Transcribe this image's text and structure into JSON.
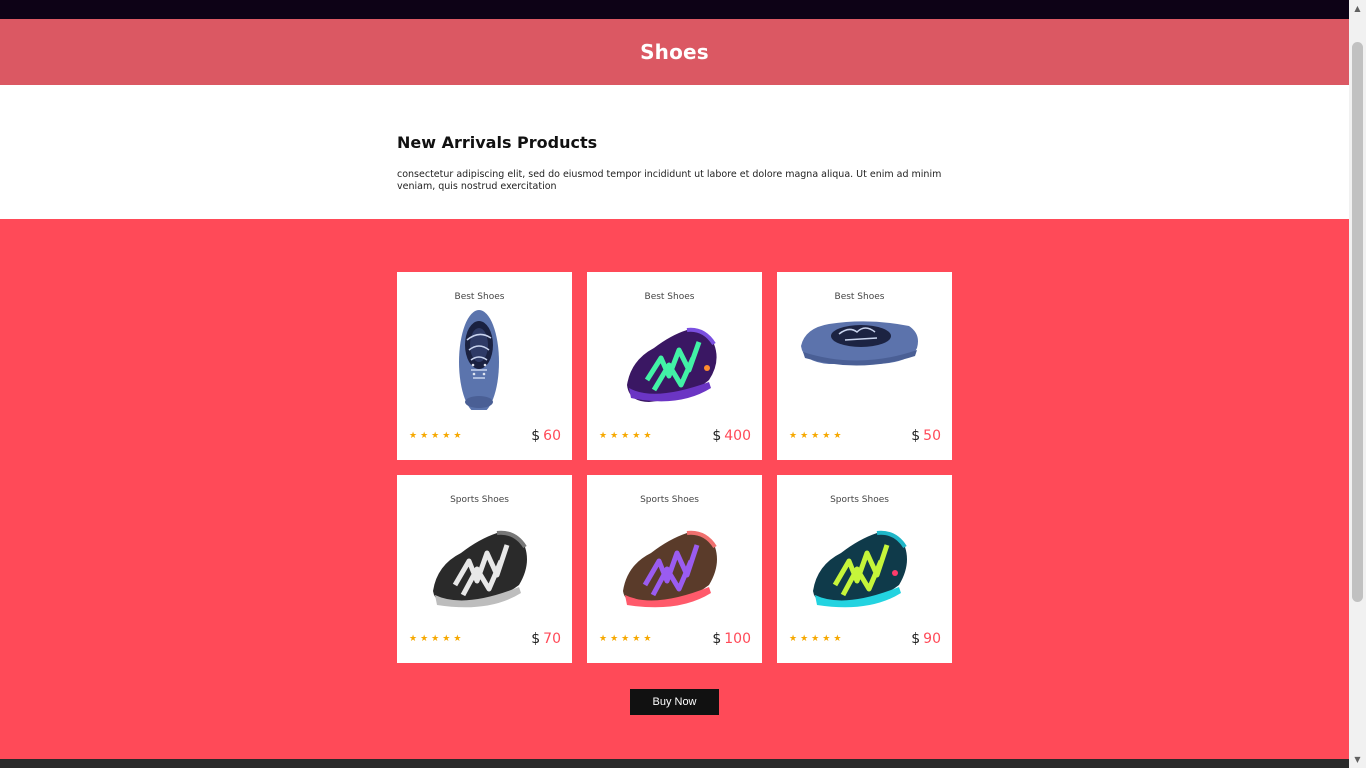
{
  "header": {
    "title": "Shoes"
  },
  "intro": {
    "heading": "New Arrivals Products",
    "text": "consectetur adipiscing elit, sed do eiusmod tempor incididunt ut labore et dolore magna aliqua. Ut enim ad minim veniam, quis nostrud exercitation"
  },
  "products": [
    {
      "category": "Best Shoes",
      "currency": "$",
      "price": "60",
      "rating": 5,
      "image": "blue-canvas-shoe-top-view"
    },
    {
      "category": "Best Shoes",
      "currency": "$",
      "price": "400",
      "rating": 5,
      "image": "purple-green-trail-runner"
    },
    {
      "category": "Best Shoes",
      "currency": "$",
      "price": "50",
      "rating": 5,
      "image": "blue-canvas-shoe-side-view"
    },
    {
      "category": "Sports Shoes",
      "currency": "$",
      "price": "70",
      "rating": 5,
      "image": "black-white-trail-runner"
    },
    {
      "category": "Sports Shoes",
      "currency": "$",
      "price": "100",
      "rating": 5,
      "image": "brown-purple-trail-runner"
    },
    {
      "category": "Sports Shoes",
      "currency": "$",
      "price": "90",
      "rating": 5,
      "image": "teal-lime-trail-runner"
    }
  ],
  "cta": {
    "label": "Buy Now"
  },
  "colors": {
    "topbar": "#0d0216",
    "banner": "#db5863",
    "products_bg": "#ff4a58",
    "price_accent": "#ff4a58",
    "star": "#f6a800",
    "button": "#111111"
  },
  "scrollbar": {
    "up_icon": "▲",
    "down_icon": "▼"
  }
}
